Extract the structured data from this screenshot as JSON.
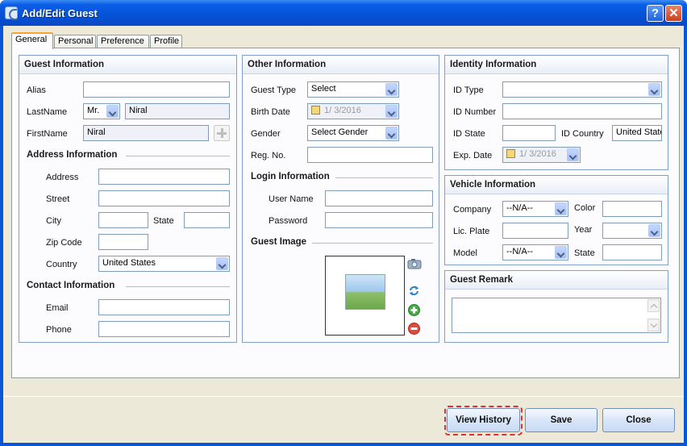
{
  "window": {
    "title": "Add/Edit Guest",
    "help": "?",
    "close": "✕"
  },
  "tabs": [
    {
      "label": "General"
    },
    {
      "label": "Personal"
    },
    {
      "label": "Preference"
    },
    {
      "label": "Profile"
    }
  ],
  "guest_info": {
    "title": "Guest Information",
    "alias_label": "Alias",
    "alias_value": "",
    "lastname_label": "LastName",
    "salutation": "Mr.",
    "lastname_value": "Niral",
    "firstname_label": "FirstName",
    "firstname_value": "Niral"
  },
  "address": {
    "title": "Address Information",
    "address_label": "Address",
    "street_label": "Street",
    "city_label": "City",
    "state_label": "State",
    "zip_label": "Zip Code",
    "country_label": "Country",
    "country_value": "United States"
  },
  "contact": {
    "title": "Contact Information",
    "email_label": "Email",
    "phone_label": "Phone"
  },
  "other": {
    "title": "Other Information",
    "guest_type_label": "Guest Type",
    "guest_type_value": "Select",
    "birth_date_label": "Birth Date",
    "birth_date_value": "1/  3/2016",
    "gender_label": "Gender",
    "gender_value": "Select Gender",
    "reg_label": "Reg. No."
  },
  "login": {
    "title": "Login Information",
    "user_label": "User Name",
    "password_label": "Password"
  },
  "image": {
    "title": "Guest Image",
    "icons": [
      "camera-icon",
      "refresh-icon",
      "add-icon",
      "remove-icon"
    ]
  },
  "identity": {
    "title": "Identity Information",
    "id_type_label": "ID Type",
    "id_number_label": "ID Number",
    "id_state_label": "ID State",
    "id_country_label": "ID Country",
    "id_country_value": "United State",
    "exp_date_label": "Exp. Date",
    "exp_date_value": "1/  3/2016"
  },
  "vehicle": {
    "title": "Vehicle Information",
    "company_label": "Company",
    "company_value": "--N/A--",
    "color_label": "Color",
    "plate_label": "Lic. Plate",
    "year_label": "Year",
    "model_label": "Model",
    "model_value": "--N/A--",
    "state_label": "State"
  },
  "remark": {
    "title": "Guest Remark"
  },
  "buttons": {
    "history": "View History",
    "save": "Save",
    "close": "Close"
  },
  "colors": {
    "title_bar": "#0552d6",
    "dialog_bg": "#ece9d8",
    "highlight": "#e0302a",
    "group_border": "#7fa0c9"
  }
}
